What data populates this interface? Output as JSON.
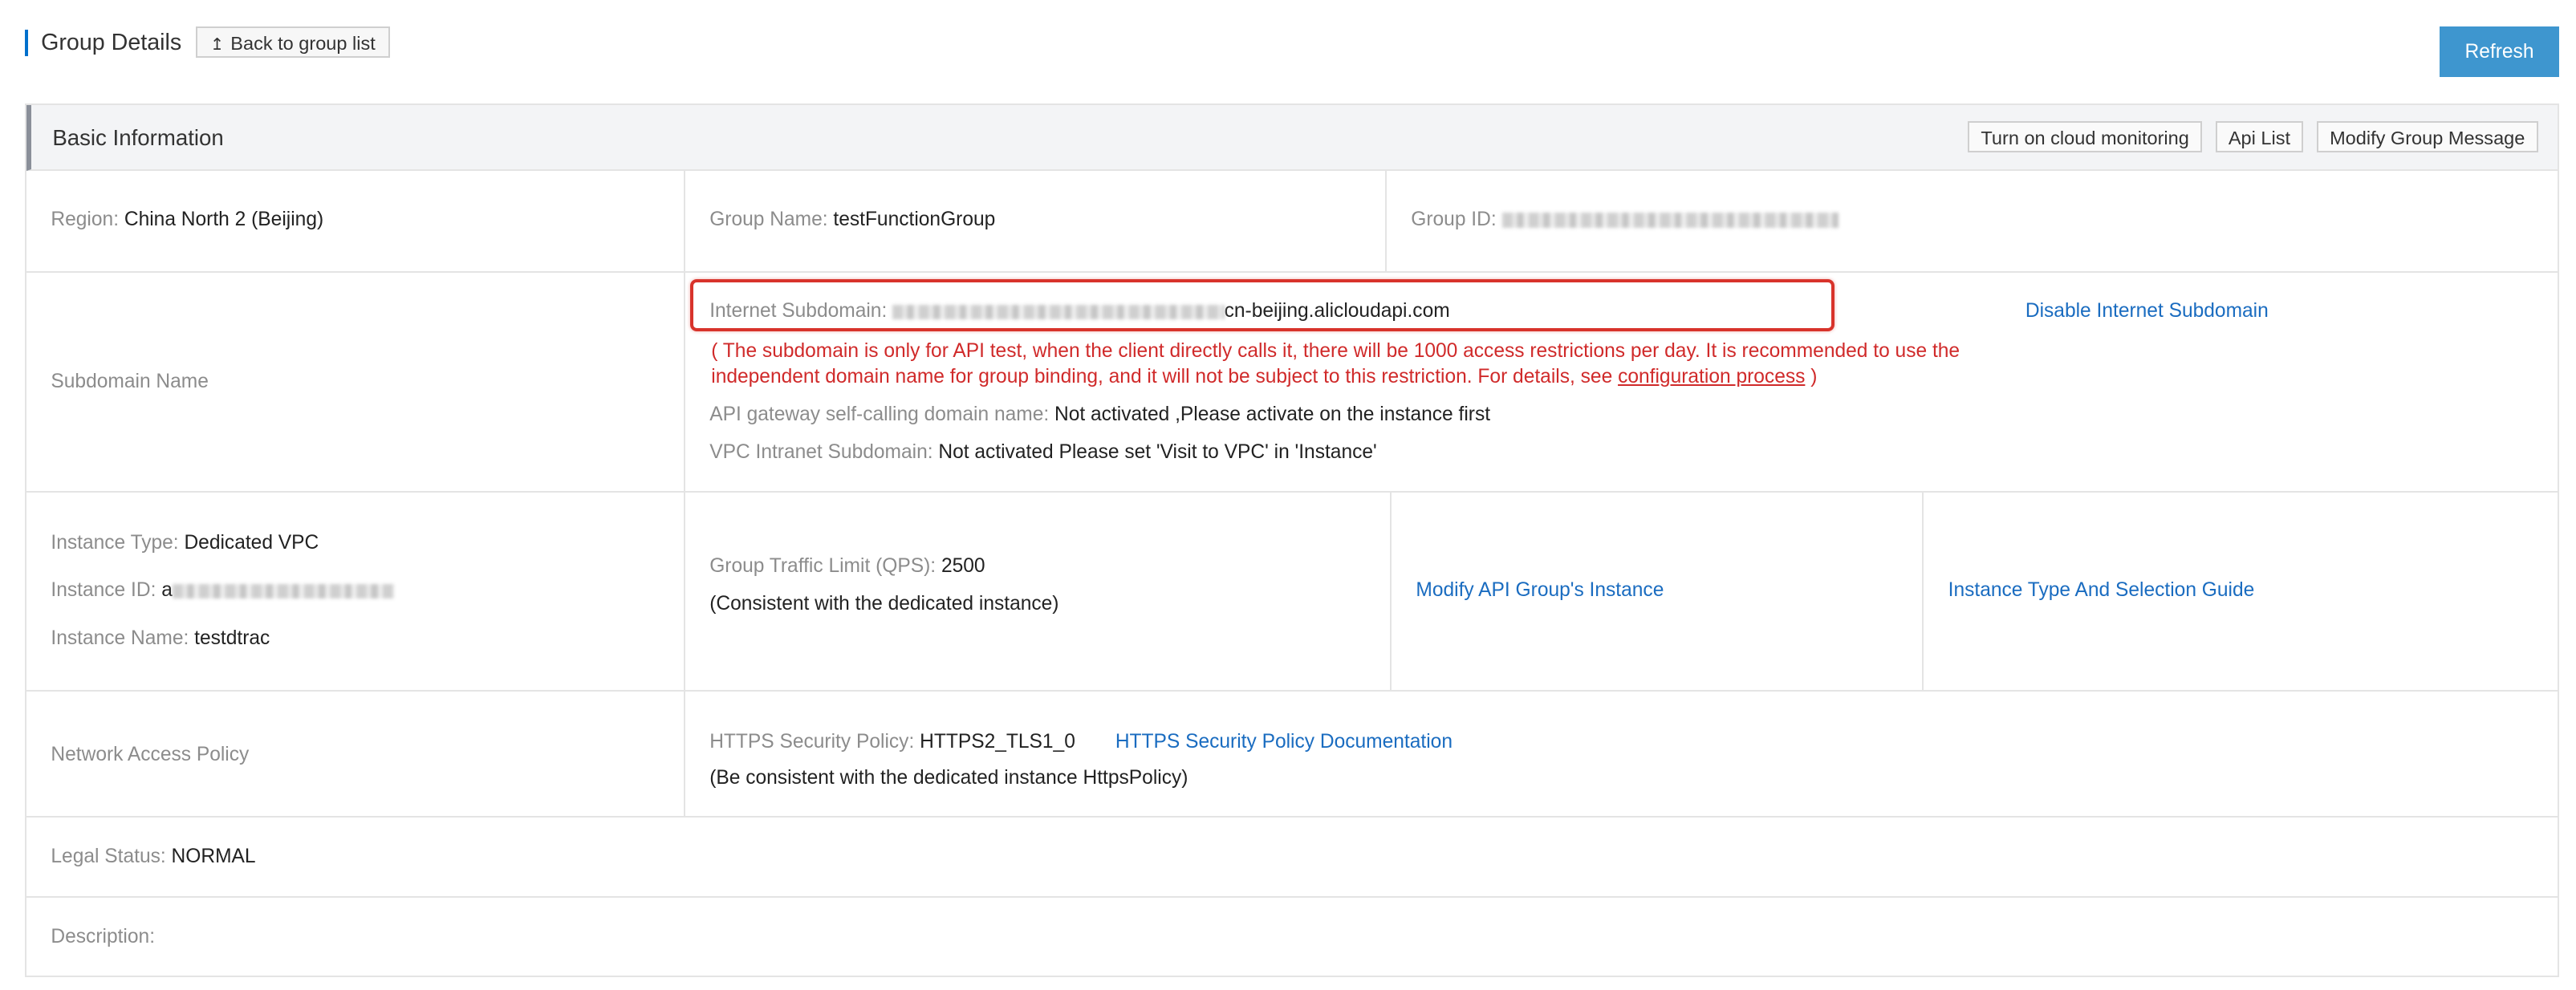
{
  "header": {
    "title": "Group Details",
    "back_label": "Back to group list",
    "back_icon": "upload-arrow-icon",
    "refresh_label": "Refresh",
    "accent_color": "#3e96cf"
  },
  "basic_info": {
    "title": "Basic Information",
    "actions": {
      "cloud_monitoring": "Turn on cloud monitoring",
      "api_list": "Api List",
      "modify_group": "Modify Group Message"
    }
  },
  "row1": {
    "region_label": "Region:",
    "region_value": "China North 2 (Beijing)",
    "group_name_label": "Group Name:",
    "group_name_value": "testFunctionGroup",
    "group_id_label": "Group ID:"
  },
  "subdomain": {
    "section_label": "Subdomain Name",
    "internet_label": "Internet Subdomain:",
    "internet_value_suffix": "cn-beijing.alicloudapi.com",
    "disable_link": "Disable Internet Subdomain",
    "warning_text": "( The subdomain is only for API test, when the client directly calls it, there will be 1000 access restrictions per day. It is recommended to use the independent domain name for group binding, and it will not be subject to this restriction. For details, see",
    "warning_link": "configuration process",
    "warning_end": ")",
    "self_call_label": "API gateway self-calling domain name:",
    "self_call_value": "Not activated ,Please activate on the instance first",
    "vpc_label": "VPC Intranet Subdomain:",
    "vpc_value": "Not activated Please set 'Visit to VPC' in 'Instance'"
  },
  "instance": {
    "type_label": "Instance Type:",
    "type_value": "Dedicated VPC",
    "id_label": "Instance ID:",
    "id_value_prefix": "a",
    "name_label": "Instance Name:",
    "name_value": "testdtrac",
    "traffic_label": "Group Traffic Limit (QPS):",
    "traffic_value": "2500",
    "traffic_note": "(Consistent with the dedicated instance)",
    "modify_link": "Modify API Group's Instance",
    "guide_link": "Instance Type And Selection Guide"
  },
  "network": {
    "section_label": "Network Access Policy",
    "https_label": "HTTPS Security Policy:",
    "https_value": "HTTPS2_TLS1_0",
    "https_doc_link": "HTTPS Security Policy Documentation",
    "https_note": "(Be consistent with the dedicated instance HttpsPolicy)"
  },
  "legal": {
    "label": "Legal Status:",
    "value": "NORMAL"
  },
  "description": {
    "label": "Description:"
  }
}
